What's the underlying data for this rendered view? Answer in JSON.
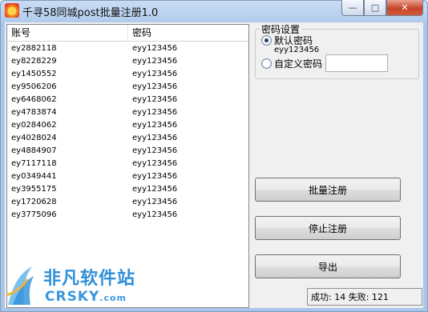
{
  "window": {
    "title": "千寻58同城post批量注册1.0",
    "caption": {
      "minimize": "—",
      "maximize": "□",
      "close": "✕"
    }
  },
  "list": {
    "columns": [
      "账号",
      "密码"
    ],
    "rows": [
      {
        "account": "ey2882118",
        "password": "eyy123456"
      },
      {
        "account": "ey8228229",
        "password": "eyy123456"
      },
      {
        "account": "ey1450552",
        "password": "eyy123456"
      },
      {
        "account": "ey9506206",
        "password": "eyy123456"
      },
      {
        "account": "ey6468062",
        "password": "eyy123456"
      },
      {
        "account": "ey4783874",
        "password": "eyy123456"
      },
      {
        "account": "ey0284062",
        "password": "eyy123456"
      },
      {
        "account": "ey4028024",
        "password": "eyy123456"
      },
      {
        "account": "ey4884907",
        "password": "eyy123456"
      },
      {
        "account": "ey7117118",
        "password": "eyy123456"
      },
      {
        "account": "ey0349441",
        "password": "eyy123456"
      },
      {
        "account": "ey3955175",
        "password": "eyy123456"
      },
      {
        "account": "ey1720628",
        "password": "eyy123456"
      },
      {
        "account": "ey3775096",
        "password": "eyy123456"
      }
    ]
  },
  "password_settings": {
    "group_title": "密码设置",
    "default_label": "默认密码",
    "default_value": "eyy123456",
    "default_selected": true,
    "custom_label": "自定义密码",
    "custom_value": ""
  },
  "buttons": {
    "batch_register": "批量注册",
    "stop_register": "停止注册",
    "export": "导出"
  },
  "status": "成功: 14 失败: 121",
  "watermark": {
    "cn": "非凡软件站",
    "en": "CRSKY",
    "en_suffix": ".com"
  }
}
